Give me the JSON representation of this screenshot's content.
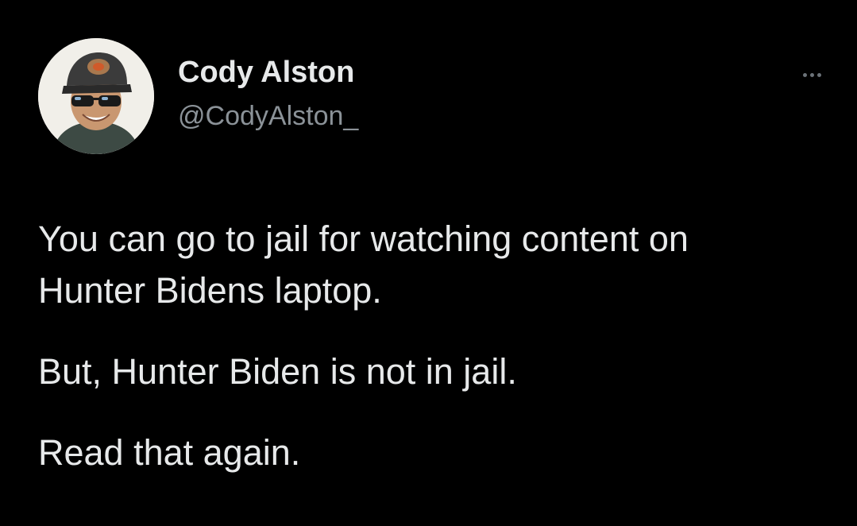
{
  "tweet": {
    "author": {
      "display_name": "Cody Alston",
      "handle": "@CodyAlston_",
      "avatar_icon": "profile-avatar"
    },
    "more_icon": "more-options-icon",
    "paragraphs": [
      "You can go to jail for watching content on Hunter Bidens laptop.",
      "But, Hunter Biden is not in jail.",
      "Read that again."
    ]
  },
  "colors": {
    "background": "#000000",
    "primary_text": "#e7e9ea",
    "secondary_text": "#8b9298"
  }
}
